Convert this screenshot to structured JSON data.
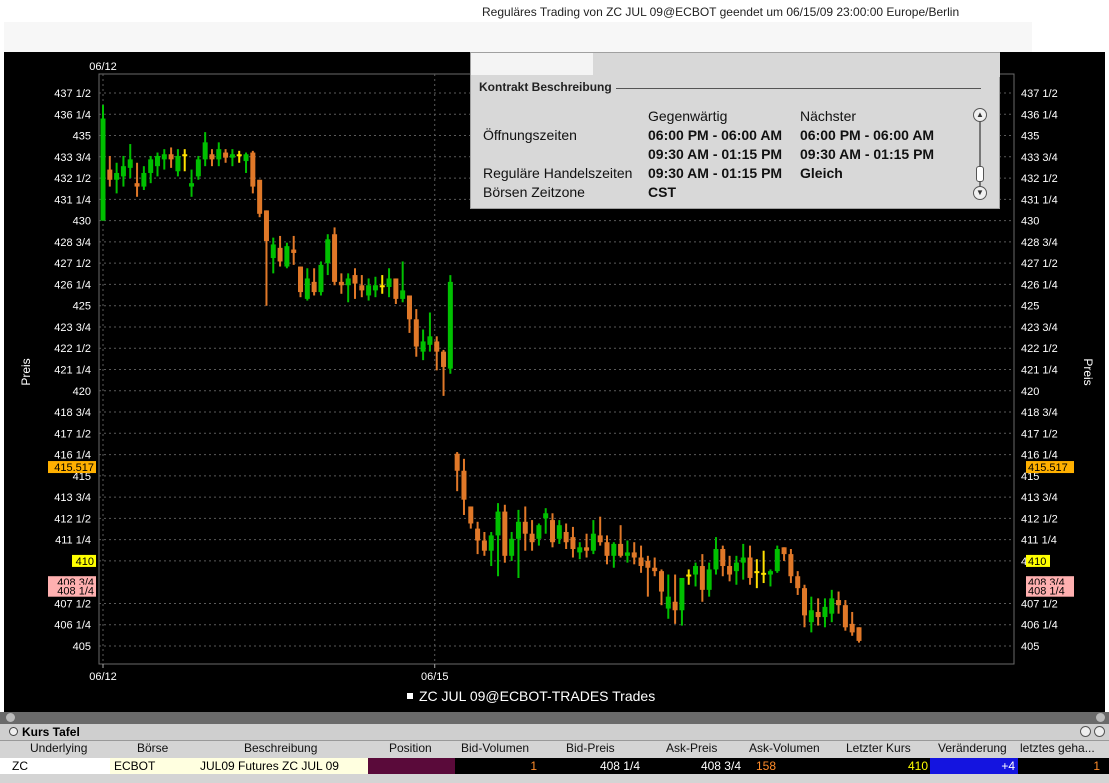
{
  "status_message": "Reguläres Trading von ZC   JUL 09@ECBOT geendet um 06/15/09 23:00:00 Europe/Berlin",
  "chart_data": {
    "type": "candlestick",
    "title": "",
    "legend": "ZC    JUL 09@ECBOT-TRADES Trades",
    "ylabel": "Preis",
    "ylim": [
      404,
      438.5
    ],
    "y_ticks": [
      {
        "v": 437.5,
        "label": "437 1/2"
      },
      {
        "v": 436.25,
        "label": "436 1/4"
      },
      {
        "v": 435,
        "label": "435"
      },
      {
        "v": 433.75,
        "label": "433 3/4"
      },
      {
        "v": 432.5,
        "label": "432 1/2"
      },
      {
        "v": 431.25,
        "label": "431 1/4"
      },
      {
        "v": 430,
        "label": "430"
      },
      {
        "v": 428.75,
        "label": "428 3/4"
      },
      {
        "v": 427.5,
        "label": "427 1/2"
      },
      {
        "v": 426.25,
        "label": "426 1/4"
      },
      {
        "v": 425,
        "label": "425"
      },
      {
        "v": 423.75,
        "label": "423 3/4"
      },
      {
        "v": 422.5,
        "label": "422 1/2"
      },
      {
        "v": 421.25,
        "label": "421 1/4"
      },
      {
        "v": 420,
        "label": "420"
      },
      {
        "v": 418.75,
        "label": "418 3/4"
      },
      {
        "v": 417.5,
        "label": "417 1/2"
      },
      {
        "v": 416.25,
        "label": "416 1/4"
      },
      {
        "v": 415,
        "label": "415"
      },
      {
        "v": 413.75,
        "label": "413 3/4"
      },
      {
        "v": 412.5,
        "label": "412 1/2"
      },
      {
        "v": 411.25,
        "label": "411 1/4"
      },
      {
        "v": 410,
        "label": "410"
      },
      {
        "v": 407.5,
        "label": "407 1/2"
      },
      {
        "v": 406.25,
        "label": "406 1/4"
      },
      {
        "v": 405,
        "label": "405"
      }
    ],
    "markers": [
      {
        "v": 415.517,
        "label": "415.517",
        "color": "#ffb000",
        "textcolor": "#000000"
      },
      {
        "v": 410,
        "label": "410",
        "color": "#ffff00",
        "textcolor": "#000000"
      },
      {
        "v": 408.75,
        "label": "408 3/4",
        "color": "#ffb0b0",
        "textcolor": "#000000"
      },
      {
        "v": 408.25,
        "label": "408 1/4",
        "color": "#ffb0b0",
        "textcolor": "#000000"
      }
    ],
    "x_labels": [
      {
        "i": 0,
        "label": "06/12"
      },
      {
        "i": 49,
        "label": "06/15"
      }
    ],
    "top_labels": [
      {
        "i": 0,
        "label": "06/12"
      }
    ],
    "candles": [
      [
        430,
        436.8,
        430,
        436
      ],
      [
        433,
        433.8,
        432,
        432.4
      ],
      [
        432.4,
        433.4,
        431.6,
        432.8
      ],
      [
        432.6,
        433.8,
        432,
        433.2
      ],
      [
        433.1,
        434.5,
        432.5,
        433.6
      ],
      [
        432.2,
        433.4,
        431.4,
        432
      ],
      [
        432,
        433.2,
        431.8,
        432.8
      ],
      [
        432.8,
        433.8,
        432.2,
        433.6
      ],
      [
        433.2,
        434,
        432.6,
        433.8
      ],
      [
        433.6,
        434.2,
        433,
        433.9
      ],
      [
        433.9,
        434.3,
        433.1,
        433.6
      ],
      [
        432.9,
        434.2,
        432.6,
        433.8
      ],
      [
        433.9,
        434.2,
        432.9,
        433.8
      ],
      [
        432,
        433,
        431.4,
        432.2
      ],
      [
        432.6,
        433.8,
        432.4,
        433.6
      ],
      [
        433.6,
        435.2,
        433.2,
        434.6
      ],
      [
        433.9,
        434.2,
        433.2,
        433.6
      ],
      [
        433.6,
        434.6,
        433.2,
        434.2
      ],
      [
        434,
        434.2,
        433.4,
        433.7
      ],
      [
        433.7,
        434.2,
        433.2,
        433.9
      ],
      [
        433.9,
        434.1,
        433.4,
        433.8
      ],
      [
        433.5,
        434,
        432.8,
        433.9
      ],
      [
        434,
        434.1,
        431.6,
        432
      ],
      [
        432.4,
        432.4,
        430.2,
        430.4
      ],
      [
        430.6,
        430.6,
        425,
        428.8
      ],
      [
        427.8,
        429,
        426.9,
        428.6
      ],
      [
        428.4,
        429.1,
        427.3,
        427.6
      ],
      [
        427.3,
        428.7,
        427.2,
        428.5
      ],
      [
        428.3,
        429.1,
        427.4,
        428.1
      ],
      [
        427.3,
        427.3,
        425.5,
        425.8
      ],
      [
        425.4,
        427.2,
        425.3,
        426.6
      ],
      [
        426.4,
        427.2,
        425.6,
        425.8
      ],
      [
        425.8,
        427.6,
        425.6,
        427.4
      ],
      [
        427.5,
        429.2,
        426.8,
        428.9
      ],
      [
        429.2,
        429.6,
        426.2,
        426.4
      ],
      [
        426.4,
        426.9,
        425.7,
        426.2
      ],
      [
        426.2,
        426.9,
        425.2,
        426.6
      ],
      [
        426.8,
        427.2,
        425.4,
        426.3
      ],
      [
        426.2,
        426.8,
        425.5,
        425.9
      ],
      [
        425.6,
        426.6,
        425.3,
        426.2
      ],
      [
        425.9,
        426.7,
        425.5,
        426.2
      ],
      [
        426.2,
        426.8,
        425.7,
        426.1
      ],
      [
        426.1,
        427.2,
        425.5,
        426.6
      ],
      [
        426.6,
        426.6,
        425.1,
        425.4
      ],
      [
        425.4,
        427.6,
        425.2,
        425.9
      ],
      [
        425.6,
        425.6,
        423.4,
        424.2
      ],
      [
        424.2,
        424.8,
        422,
        422.6
      ],
      [
        422.3,
        423.6,
        421.8,
        422.9
      ],
      [
        422.7,
        424.6,
        422.3,
        423.2
      ],
      [
        422.9,
        423.2,
        421.2,
        422.3
      ],
      [
        422.3,
        422.4,
        419.7,
        421.4
      ],
      [
        421.3,
        426.8,
        421,
        426.4
      ],
      [
        416.3,
        416.4,
        414.1,
        415.3
      ],
      [
        415.3,
        416,
        412.7,
        413.6
      ],
      [
        413.2,
        413.2,
        411.9,
        412.2
      ],
      [
        411.9,
        412.3,
        410.4,
        411.2
      ],
      [
        411.2,
        411.7,
        410.3,
        410.6
      ],
      [
        410.6,
        411.7,
        409.7,
        411.5
      ],
      [
        411.5,
        413.4,
        409.1,
        412.9
      ],
      [
        412.9,
        413.3,
        409.9,
        410.3
      ],
      [
        410.3,
        411.7,
        410,
        411.3
      ],
      [
        411.3,
        413,
        409,
        412.3
      ],
      [
        412.3,
        413.2,
        410.6,
        411.6
      ],
      [
        411.6,
        412.4,
        410.6,
        411.1
      ],
      [
        411.3,
        412.2,
        410.9,
        412.1
      ],
      [
        412.5,
        413.1,
        411.6,
        412.8
      ],
      [
        412.4,
        412.8,
        410.8,
        411.1
      ],
      [
        411.3,
        412.4,
        411,
        412.1
      ],
      [
        411.7,
        412.2,
        410.7,
        411.1
      ],
      [
        411.4,
        412,
        410.2,
        410.7
      ],
      [
        410.5,
        411.1,
        410.1,
        410.8
      ],
      [
        410.8,
        411.6,
        410.2,
        410.6
      ],
      [
        410.6,
        412.4,
        410.4,
        411.6
      ],
      [
        411.5,
        412.6,
        410.9,
        411.1
      ],
      [
        411.1,
        411.5,
        409.8,
        410.3
      ],
      [
        410.3,
        411.1,
        409.6,
        411
      ],
      [
        411,
        412.1,
        410.2,
        410.3
      ],
      [
        410.3,
        411.2,
        409.9,
        410.5
      ],
      [
        410.5,
        411.1,
        409.8,
        410.2
      ],
      [
        410.2,
        410.9,
        409.3,
        409.7
      ],
      [
        410,
        410.3,
        407.9,
        409.6
      ],
      [
        409.6,
        410.2,
        409.1,
        409.4
      ],
      [
        409.4,
        409.5,
        407.4,
        408.2
      ],
      [
        407.2,
        409.2,
        406.6,
        407.9
      ],
      [
        407.6,
        409.2,
        406.3,
        407.1
      ],
      [
        407.1,
        408.8,
        406.2,
        409
      ],
      [
        409.1,
        409.5,
        408.6,
        409.2
      ],
      [
        409.2,
        409.9,
        408.5,
        409.7
      ],
      [
        409.7,
        410.4,
        407.6,
        408.3
      ],
      [
        408.3,
        409.9,
        407.9,
        409.5
      ],
      [
        409.5,
        411.4,
        409.2,
        410.7
      ],
      [
        410.7,
        410.9,
        409.1,
        409.7
      ],
      [
        409.7,
        410.3,
        408.8,
        409.2
      ],
      [
        409.4,
        410.3,
        408.6,
        409.9
      ],
      [
        409.9,
        411,
        408.9,
        410.2
      ],
      [
        410.2,
        410.9,
        408.6,
        409
      ],
      [
        409.4,
        410.1,
        408.4,
        409.3
      ],
      [
        409.3,
        410.6,
        408.7,
        409.2
      ],
      [
        409.2,
        409.5,
        408.5,
        409.4
      ],
      [
        409.4,
        410.9,
        409.3,
        410.7
      ],
      [
        410.8,
        410.8,
        410,
        410.4
      ],
      [
        410.4,
        410.7,
        408.7,
        409.1
      ],
      [
        409.1,
        409.4,
        408,
        408.4
      ],
      [
        408.4,
        408.6,
        406.1,
        406.8
      ],
      [
        406.4,
        407.9,
        405.8,
        407.1
      ],
      [
        407,
        407.8,
        406.2,
        406.7
      ],
      [
        406.7,
        407.8,
        406.1,
        407.3
      ],
      [
        406.9,
        408.3,
        406.4,
        407.8
      ],
      [
        407.7,
        408.2,
        406.9,
        407.4
      ],
      [
        407.4,
        407.7,
        405.9,
        406.1
      ],
      [
        406.3,
        407,
        405.6,
        405.8
      ],
      [
        406.1,
        406.1,
        405.2,
        405.3
      ]
    ],
    "colors": {
      "up": "#00c000",
      "down": "#e07828",
      "doji": "#ffe000",
      "grid": "#5a5a5a",
      "axis_text": "#ffffff"
    }
  },
  "tooltip": {
    "title": "Kontrakt Beschreibung",
    "col_current": "Gegenwärtig",
    "col_next": "Nächster",
    "rows": [
      {
        "label": "Öffnungszeiten",
        "current": "06:00 PM - 06:00 AM",
        "next": "06:00 PM - 06:00 AM"
      },
      {
        "label": "",
        "current": "09:30 AM - 01:15 PM",
        "next": "09:30 AM - 01:15 PM"
      },
      {
        "label": "Reguläre Handelszeiten",
        "current": "09:30 AM - 01:15 PM",
        "next": "Gleich"
      },
      {
        "label": "Börsen Zeitzone",
        "current": "CST",
        "next": ""
      }
    ]
  },
  "panel": {
    "title": "Kurs Tafel",
    "columns": [
      "Underlying",
      "Börse",
      "Beschreibung",
      "Position",
      "Bid-Volumen",
      "Bid-Preis",
      "Ask-Preis",
      "Ask-Volumen",
      "Letzter Kurs",
      "Veränderung",
      "letztes geha..."
    ],
    "row": {
      "underlying": "ZC",
      "exchange": "ECBOT",
      "description": "JUL09 Futures ZC    JUL 09",
      "position": "",
      "bid_volume": "1",
      "bid_price": "408 1/4",
      "ask_price": "408 3/4",
      "ask_volume": "158",
      "last": "410",
      "change": "+4",
      "last_traded": "1"
    }
  }
}
